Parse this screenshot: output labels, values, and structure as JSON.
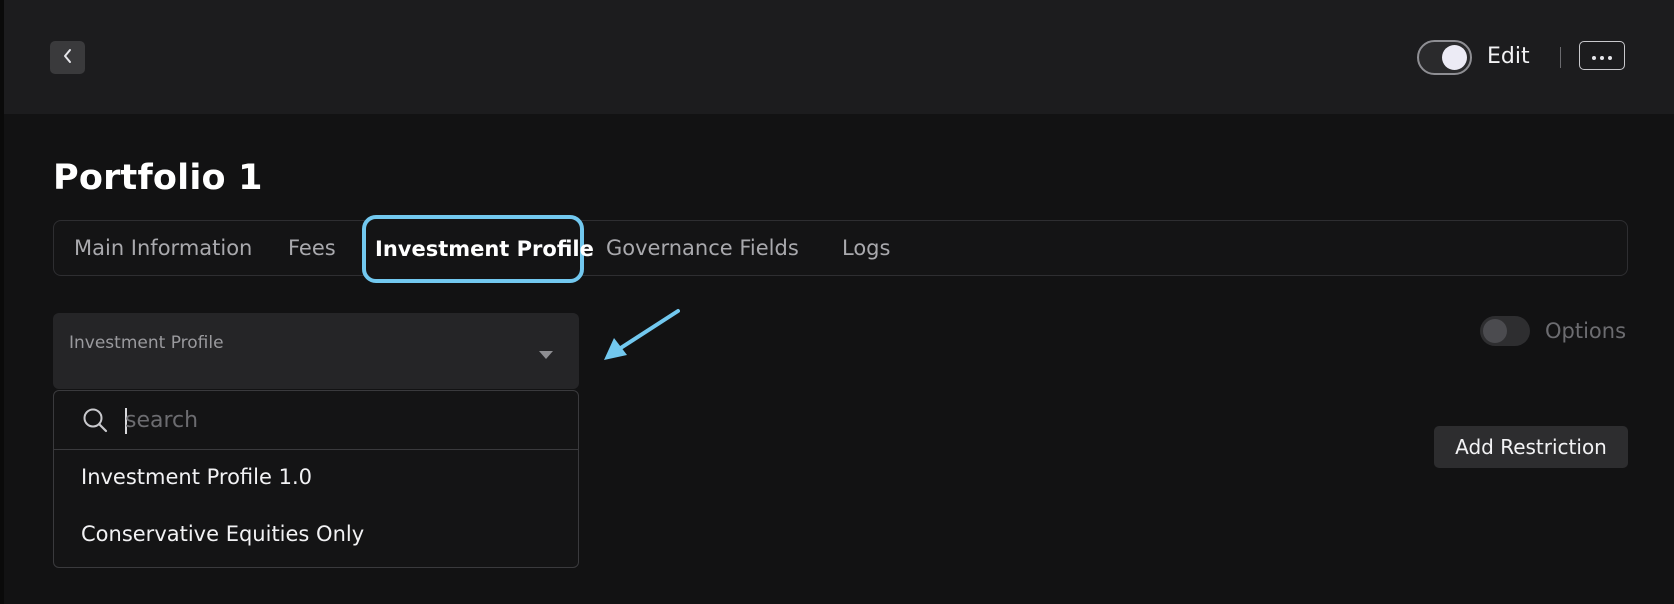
{
  "header": {
    "back_icon": "chevron-left-icon",
    "edit_toggle_on": true,
    "edit_label": "Edit",
    "more_icon": "more-horizontal-icon"
  },
  "page": {
    "title": "Portfolio 1"
  },
  "tabs": [
    {
      "label": "Main Information",
      "active": false
    },
    {
      "label": "Fees",
      "active": false
    },
    {
      "label": "Investment Profile",
      "active": true
    },
    {
      "label": "Governance Fields",
      "active": false
    },
    {
      "label": "Logs",
      "active": false
    }
  ],
  "investment_profile_select": {
    "label": "Investment Profile",
    "caret_icon": "caret-down-icon"
  },
  "dropdown": {
    "search_placeholder": "search",
    "search_value": "",
    "search_icon": "search-icon",
    "options": [
      {
        "label": "Investment Profile 1.0"
      },
      {
        "label": "Conservative Equities Only"
      }
    ]
  },
  "options_toggle": {
    "label": "Options",
    "on": false
  },
  "actions": {
    "add_restriction_label": "Add Restriction"
  },
  "annotation": {
    "arrow_icon": "pointer-arrow-icon",
    "arrow_color": "#72c8ef",
    "highlight_color": "#72c8ef"
  }
}
